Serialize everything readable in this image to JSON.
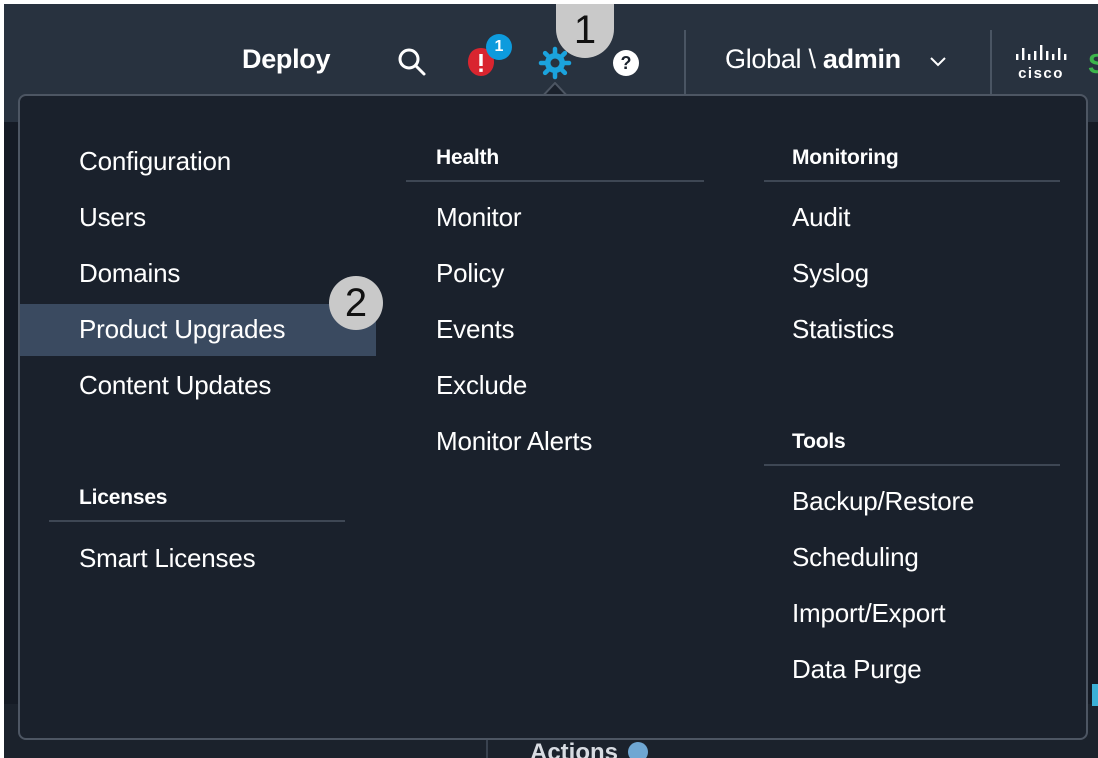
{
  "topbar": {
    "deploy_label": "Deploy",
    "alert_count": "1",
    "help_glyph": "?",
    "domain_prefix": "Global \\ ",
    "domain_user": "admin",
    "brand_logo": "cisco",
    "icons": [
      "search-icon",
      "alert-icon",
      "gear-icon",
      "help-icon",
      "chevron-down-icon",
      "cisco-logo"
    ]
  },
  "menu": {
    "column1": {
      "items": [
        "Configuration",
        "Users",
        "Domains",
        "Product Upgrades",
        "Content Updates"
      ],
      "licenses_heading": "Licenses",
      "license_items": [
        "Smart Licenses"
      ]
    },
    "column2": {
      "heading": "Health",
      "items": [
        "Monitor",
        "Policy",
        "Events",
        "Exclude",
        "Monitor Alerts"
      ]
    },
    "column3": {
      "monitoring_heading": "Monitoring",
      "monitoring_items": [
        "Audit",
        "Syslog",
        "Statistics"
      ],
      "tools_heading": "Tools",
      "tools_items": [
        "Backup/Restore",
        "Scheduling",
        "Import/Export",
        "Data Purge"
      ]
    },
    "selected_item": "Product Upgrades"
  },
  "background": {
    "actions_label": "Actions"
  },
  "callouts": [
    "1",
    "2"
  ],
  "colors": {
    "topbar_bg": "#28323f",
    "menu_bg": "#1a212c",
    "highlight_bg": "#3a4a60",
    "gear_accent": "#1ba3dd",
    "alert_red": "#d9252f",
    "badge_blue": "#0d9bdd",
    "callout_gray": "#c9c9c9"
  }
}
